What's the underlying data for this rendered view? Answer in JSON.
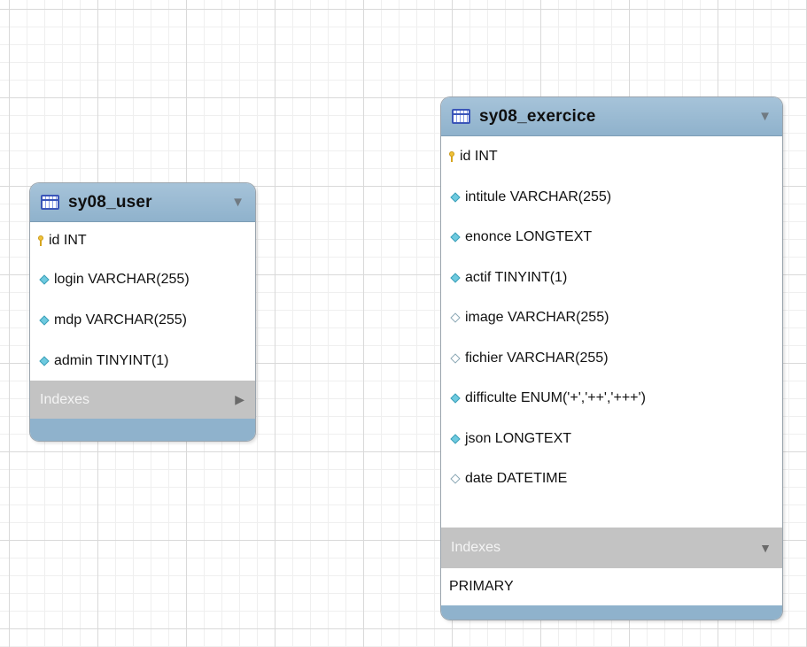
{
  "user_table": {
    "title": "sy08_user",
    "columns": [
      {
        "text": "id INT",
        "icon": "primary-key-icon"
      },
      {
        "text": "login VARCHAR(255)",
        "icon": "filled-diamond-icon"
      },
      {
        "text": "mdp VARCHAR(255)",
        "icon": "filled-diamond-icon"
      },
      {
        "text": "admin TINYINT(1)",
        "icon": "filled-diamond-icon"
      }
    ],
    "indexes_label": "Indexes",
    "indexes_state": "collapsed",
    "indexes_arrow": "▶"
  },
  "exercice_table": {
    "title": "sy08_exercice",
    "columns": [
      {
        "text": "id INT",
        "icon": "primary-key-icon"
      },
      {
        "text": "intitule VARCHAR(255)",
        "icon": "filled-diamond-icon"
      },
      {
        "text": "enonce LONGTEXT",
        "icon": "filled-diamond-icon"
      },
      {
        "text": "actif TINYINT(1)",
        "icon": "filled-diamond-icon"
      },
      {
        "text": "image VARCHAR(255)",
        "icon": "hollow-diamond-icon"
      },
      {
        "text": "fichier VARCHAR(255)",
        "icon": "hollow-diamond-icon"
      },
      {
        "text": "difficulte ENUM('+','++','+++')",
        "icon": "filled-diamond-icon"
      },
      {
        "text": "json LONGTEXT",
        "icon": "filled-diamond-icon"
      },
      {
        "text": "date DATETIME",
        "icon": "hollow-diamond-icon"
      }
    ],
    "indexes_label": "Indexes",
    "indexes_state": "expanded",
    "indexes_arrow": "▼",
    "indexes": [
      "PRIMARY"
    ]
  },
  "header_arrow": "▼",
  "colors": {
    "header_blue": "#8fb2cc",
    "indexes_gray": "#c3c3c3",
    "key_gold": "#f0c23a",
    "diamond_cyan": "#6ecadf"
  }
}
